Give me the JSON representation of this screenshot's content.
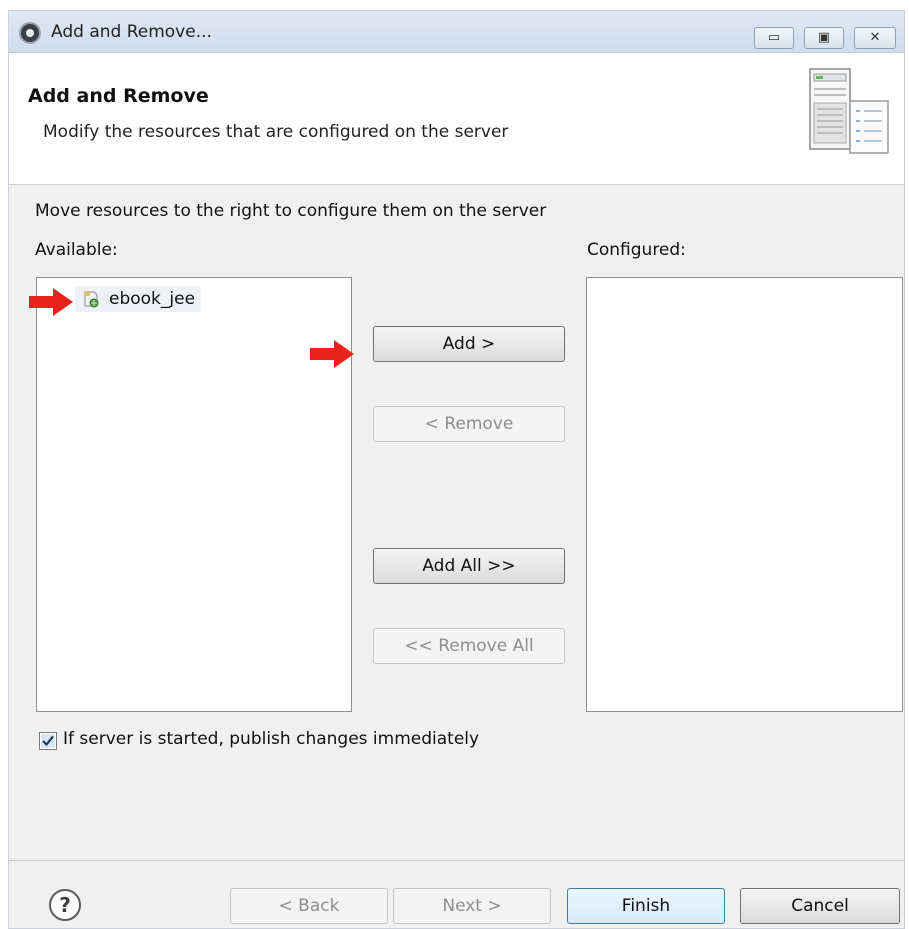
{
  "window": {
    "title": "Add and Remove...",
    "controls": {
      "minimize": "▭",
      "maximize": "▣",
      "close": "✕"
    }
  },
  "header": {
    "title": "Add and Remove",
    "subtitle": "Modify the resources that are configured on the server",
    "icon": "server-banner-icon"
  },
  "content": {
    "instruction": "Move resources to the right to configure them on the server",
    "available_label": "Available:",
    "configured_label": "Configured:",
    "available_items": [
      {
        "label": "ebook_jee",
        "icon": "web-project-icon"
      }
    ],
    "configured_items": []
  },
  "actions": {
    "add": "Add >",
    "remove": "< Remove",
    "add_all": "Add All >>",
    "remove_all": "<< Remove All"
  },
  "option": {
    "publish_label": "If server is started, publish changes immediately",
    "publish_checked": true
  },
  "footer": {
    "help": "?",
    "back": "< Back",
    "next": "Next >",
    "finish": "Finish",
    "cancel": "Cancel"
  },
  "colors": {
    "annotation_arrow": "#e8231d",
    "default_button_border": "#3c7fb1"
  }
}
